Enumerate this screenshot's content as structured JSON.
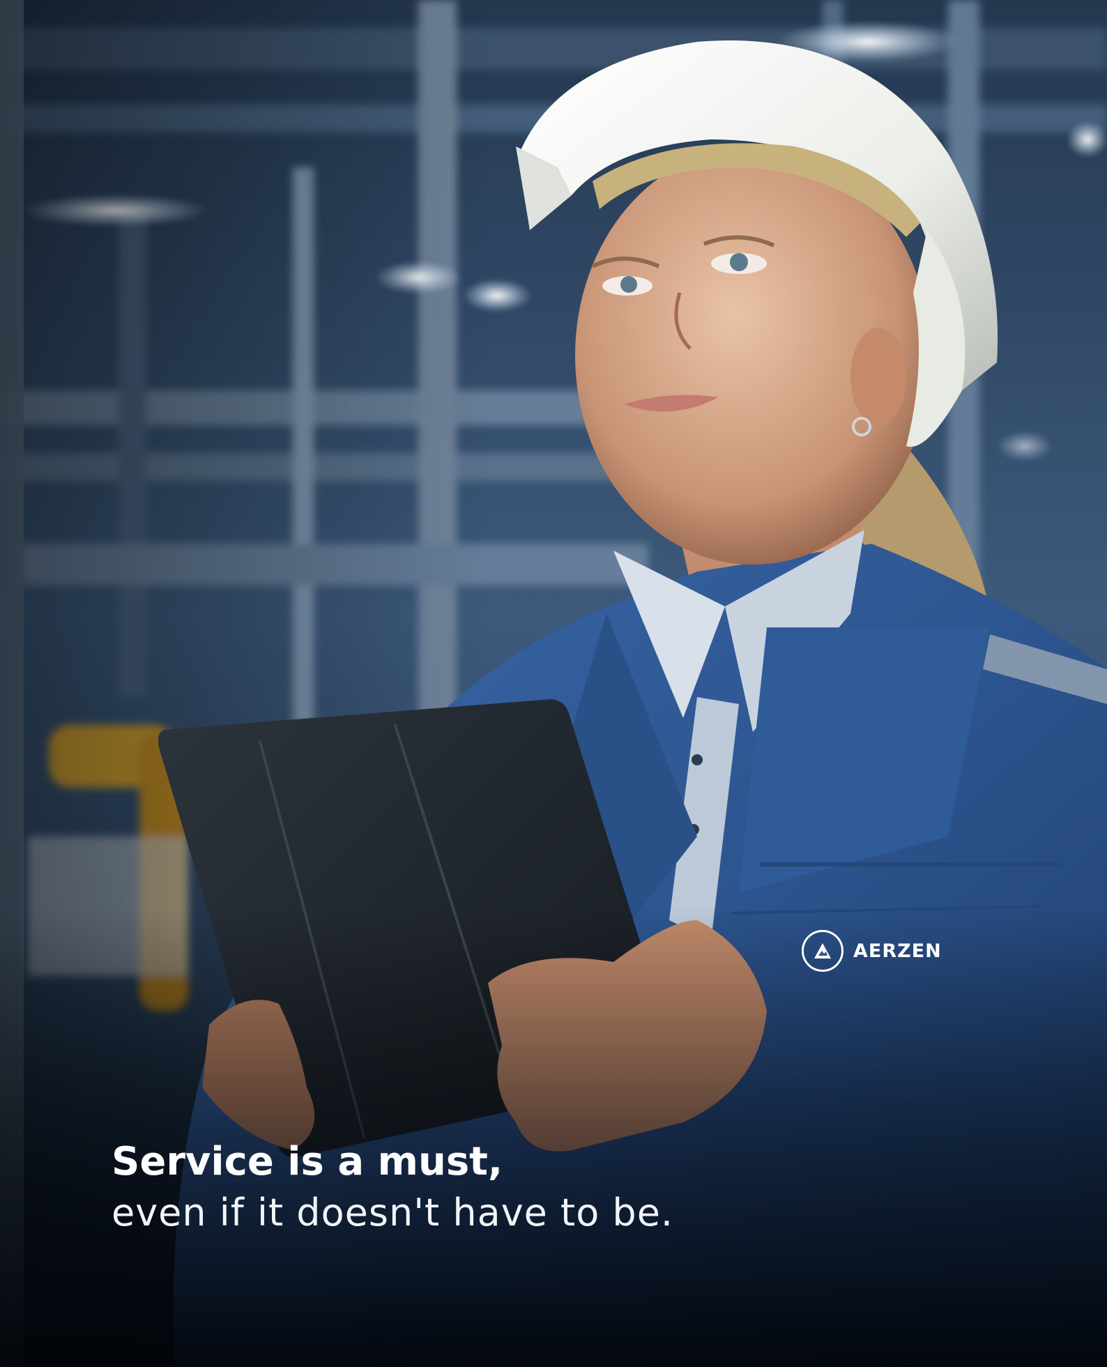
{
  "photo": {
    "subject": "worker-in-hard-hat-with-tablet",
    "colors": {
      "background_blue": "#2f4d70",
      "jacket_blue": "#2e5a9a",
      "helmet_white": "#f1f2ee",
      "shadow_dark": "#02050a"
    }
  },
  "jacket_logo": {
    "icon": "aerzen-logo-icon",
    "text": "AERZEN"
  },
  "headline": {
    "line1": "Service is a must,",
    "line2": "even if it doesn't have to be."
  }
}
